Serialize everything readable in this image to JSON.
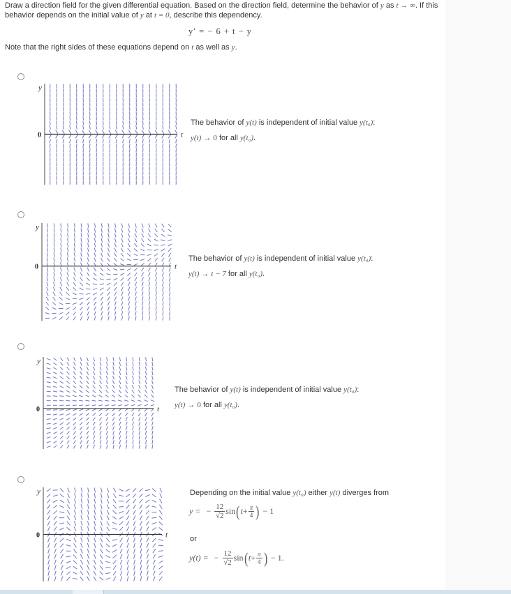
{
  "question": {
    "intro_part1": "Draw a direction field for the given differential equation. Based on the direction field, determine the behavior of ",
    "var_y": "y",
    "intro_part2": " as ",
    "var_t": "t",
    "arrow": " → ∞",
    "intro_part3": ". If this behavior depends on the initial value of ",
    "intro_part4": " at ",
    "t_eq_zero": "t = 0",
    "intro_part5": ", describe this dependency.",
    "equation": "y′  =  − 6 + t − y",
    "note_part1": "Note that the right sides of these equations depend on ",
    "note_part2": " as well as ",
    "note_end": "."
  },
  "axis_labels": {
    "y": "y",
    "t": "t",
    "zero": "0"
  },
  "field_color": "#5a5fb8",
  "options": [
    {
      "id": "option-a",
      "selected": false,
      "field": "y' = -y*|y|^0 (attracted to y=0, steep vertical away)",
      "line1_prefix": "The behavior of ",
      "line1_fn": "y(t)",
      "line1_mid": " is independent of initial value ",
      "line1_init": "y(t₀)",
      "line1_end": ":",
      "line2_fn": "y(t)",
      "line2_arrow": " → ",
      "line2_limit": "0",
      "line2_mid": " for all ",
      "line2_init": "y(t₀)",
      "line2_end": "."
    },
    {
      "id": "option-b",
      "selected": false,
      "field": "y' = -6 + t - y",
      "line1_prefix": "The behavior of ",
      "line1_fn": "y(t)",
      "line1_mid": " is independent of initial value ",
      "line1_init": "y(t₀)",
      "line1_end": ":",
      "line2_fn": "y(t)",
      "line2_arrow": " → ",
      "line2_limit": "t − 7",
      "line2_mid": " for all ",
      "line2_init": "y(t₀)",
      "line2_end": "."
    },
    {
      "id": "option-c",
      "selected": false,
      "field": "y' = -t*y (converging to 0)",
      "line1_prefix": "The behavior of ",
      "line1_fn": "y(t)",
      "line1_mid": " is independent of initial value ",
      "line1_init": "y(t₀)",
      "line1_end": ":",
      "line2_fn": "y(t)",
      "line2_arrow": " → ",
      "line2_limit": "0",
      "line2_mid": " for all ",
      "line2_init": "y(t₀)",
      "line2_end": "."
    },
    {
      "id": "option-d",
      "selected": false,
      "field": "y' = y + 1 + 12 cos-type oscillation",
      "line1_prefix": "Depending on the initial value ",
      "line1_init": "y(t₀)",
      "line1_mid": " either ",
      "line1_fn": "y(t)",
      "line1_end": " diverges from",
      "formula1_lhs": "y  =",
      "or_label": "or",
      "formula2_lhs": "y(t)  =",
      "minus": "−",
      "coef_num": "12",
      "coef_den": "√2",
      "sin": "sin",
      "t_var": "t",
      "plus": " + ",
      "pi": "π",
      "four": "4",
      "tail1": "−  1",
      "tail2": "−  1."
    }
  ]
}
